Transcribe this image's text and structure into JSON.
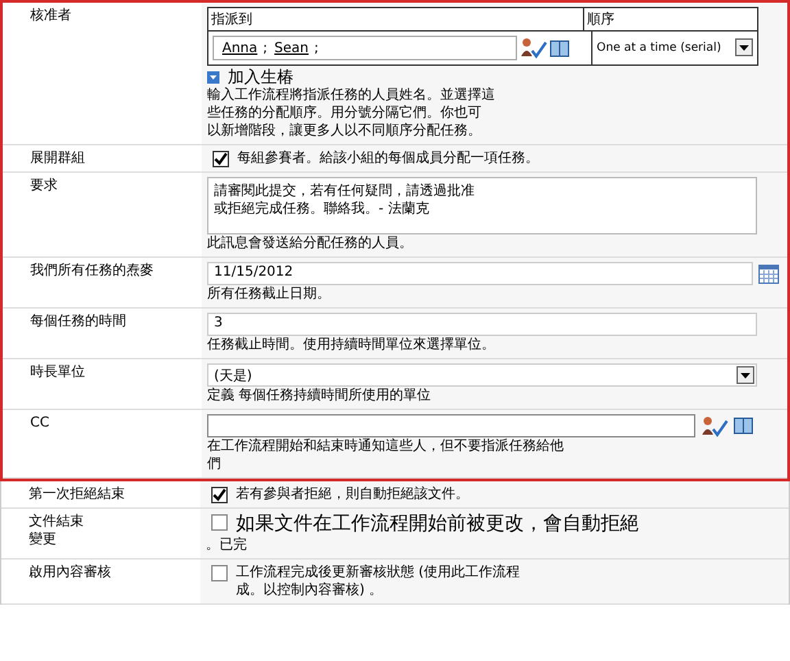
{
  "highlighted_rows": [
    {
      "kind": "approvers",
      "label": [
        "核准者"
      ],
      "assign_header": "指派到",
      "order_header": "順序",
      "people": [
        "Anna",
        "Sean"
      ],
      "separator": ";",
      "order_value": "One at a time (serial)",
      "add_stage": "加入生椿",
      "help": [
        "輸入工作流程將指派任務的人員姓名。並選擇這",
        "些任務的分配順序。用分號分隔它們。你也可",
        "以新增階段，讓更多人以不同順序分配任務。"
      ]
    },
    {
      "kind": "checkbox",
      "label": [
        "展開群組"
      ],
      "text": [
        "每組參賽者。給該小組的每個成員分配一項任務。"
      ],
      "checked": true,
      "large": false
    },
    {
      "kind": "textarea",
      "label": [
        "要求"
      ],
      "value": [
        "請審閱此提交，若有任何疑問，請透過批准",
        "或拒絕完成任務。聯絡我。- 法蘭克"
      ],
      "help": [
        "此訊息會發送給分配任務的人員。"
      ]
    },
    {
      "kind": "date",
      "label": [
        "我們所有任務的焘麥"
      ],
      "value": "11/15/2012",
      "help": [
        "所有任務截止日期。"
      ]
    },
    {
      "kind": "text",
      "label": [
        "每個任務的時間"
      ],
      "value": "3",
      "help": [
        "任務截止時間。使用持續時間單位來選擇單位。"
      ]
    },
    {
      "kind": "select",
      "label": [
        "時長單位"
      ],
      "value": "(天是)",
      "help": [
        "定義 每個任務持續時間所使用的單位"
      ]
    },
    {
      "kind": "people",
      "label": [
        "CC"
      ],
      "help": [
        "在工作流程開始和結束時通知這些人，但不要指派任務給他",
        "們"
      ]
    }
  ],
  "other_rows": [
    {
      "kind": "checkbox",
      "label": [
        "第一次拒絕結束"
      ],
      "text": [
        "若有參與者拒絕，則自動拒絕該文件。"
      ],
      "checked": true,
      "large": false
    },
    {
      "kind": "checkbox",
      "label": [
        "文件結束",
        "變更"
      ],
      "text": [
        "如果文件在工作流程開始前被更改，會自動拒絕"
      ],
      "help": [
        "。已完"
      ],
      "checked": false,
      "large": true
    },
    {
      "kind": "checkbox",
      "label": [
        "啟用內容審核"
      ],
      "text": [
        "工作流程完成後更新審核狀態 (使用此工作流程",
        "成。以控制內容審核) 。"
      ],
      "checked": false,
      "large": false
    }
  ]
}
